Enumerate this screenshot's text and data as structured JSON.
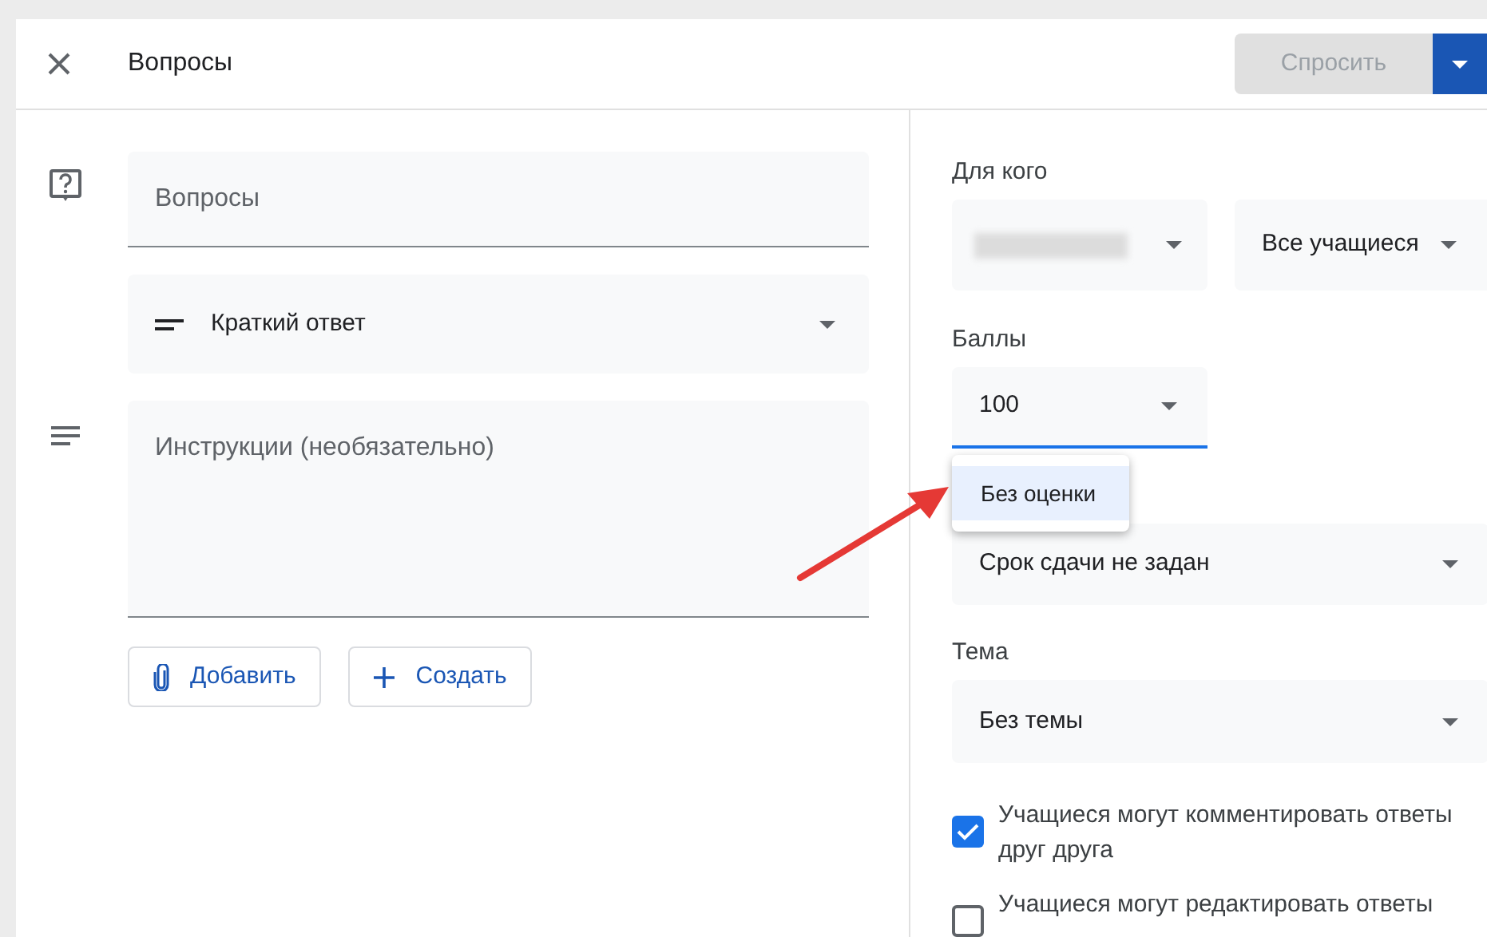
{
  "header": {
    "title": "Вопросы",
    "ask_button": {
      "label": "Спросить",
      "disabled": true
    }
  },
  "question": {
    "placeholder": "Вопросы"
  },
  "answer_type": {
    "value": "Краткий ответ"
  },
  "instructions": {
    "placeholder": "Инструкции (необязательно)"
  },
  "buttons": [
    {
      "kind": "attach",
      "label": "Добавить"
    },
    {
      "kind": "create",
      "label": "Создать"
    }
  ],
  "for_whom": {
    "label": "Для кого",
    "students": "Все учащиеся"
  },
  "points": {
    "label": "Баллы",
    "value": "100",
    "menu": [
      {
        "label": "Без оценки",
        "selected": true
      }
    ]
  },
  "due": {
    "value": "Срок сдачи не задан"
  },
  "topic": {
    "label": "Тема",
    "value": "Без темы"
  },
  "options": [
    {
      "label": "Учащиеся могут комментировать ответы друг друга",
      "checked": true
    },
    {
      "label": "Учащиеся могут редактировать ответы",
      "checked": false
    }
  ]
}
